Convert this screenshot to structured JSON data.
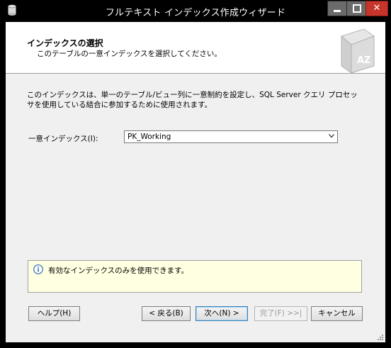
{
  "window": {
    "title": "フルテキスト インデックス作成ウィザード",
    "controls": {
      "minimize": "minimize-icon",
      "maximize": "maximize-icon",
      "close": "close-icon"
    }
  },
  "header": {
    "title": "インデックスの選択",
    "subtitle": "このテーブルの一意インデックスを選択してください。"
  },
  "body": {
    "description": "このインデックスは、単一のテーブル/ビュー列に一意制約を設定し、SQL Server クエリ プロセッサを使用している結合に参加するために使用されます。",
    "unique_index_label": "一意インデックス(I):",
    "unique_index_value": "PK_Working"
  },
  "info": {
    "message": "有効なインデックスのみを使用できます。",
    "icon": "info-icon"
  },
  "buttons": {
    "help": "ヘルプ(H)",
    "back": "< 戻る(B)",
    "next": "次へ(N) >",
    "finish": "完了(F) >>|",
    "cancel": "キャンセル"
  },
  "colors": {
    "titlebar": "#000000",
    "close_button": "#c7342a",
    "info_background": "#ffffe1",
    "default_button_border": "#3c7fb1"
  }
}
